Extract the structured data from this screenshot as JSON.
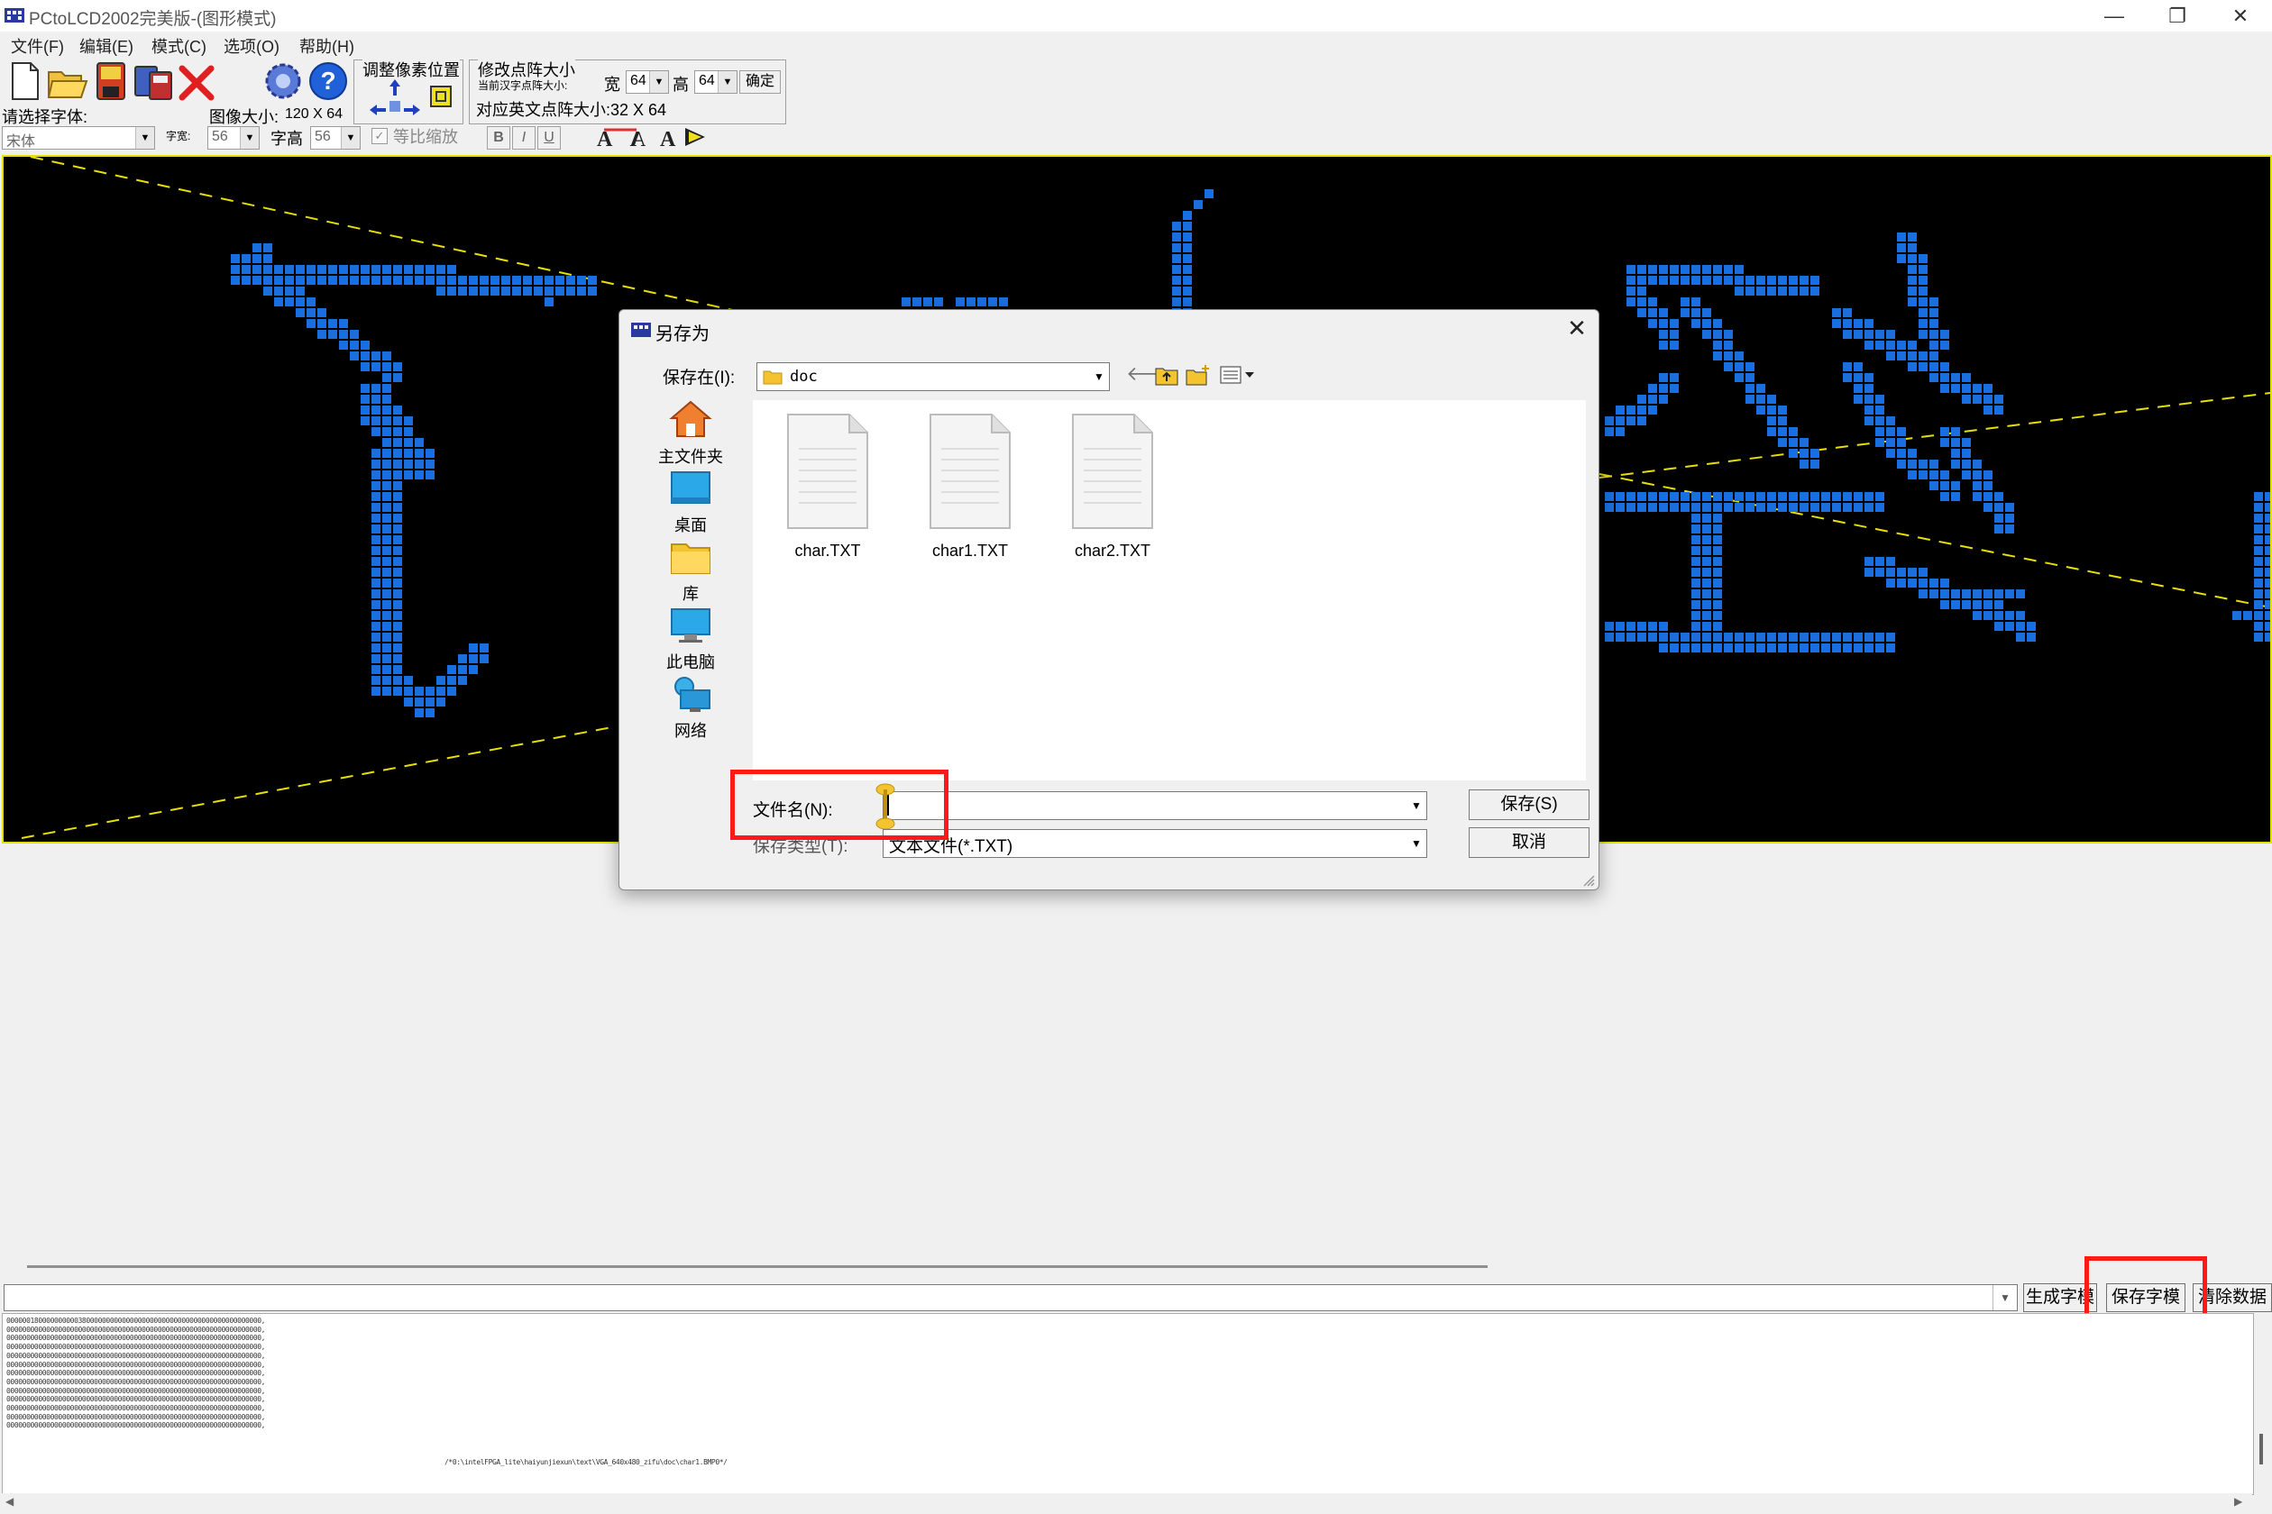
{
  "window": {
    "title": "PCtoLCD2002完美版-(图形模式)",
    "minimize": "—",
    "restore": "❐",
    "close": "✕"
  },
  "menu": [
    "文件(F)",
    "编辑(E)",
    "模式(C)",
    "选项(O)",
    "帮助(H)"
  ],
  "toolbar": {
    "pixel_position_label": "调整像素位置",
    "resize_label": "修改点阵大小",
    "resize_sub": "当前汉字点阵大小:",
    "width_label": "宽",
    "width_value": "64",
    "height_label": "高",
    "height_value": "64",
    "apply_label": "确定",
    "en_size_label": "对应英文点阵大小:32 X 64",
    "select_font_label": "请选择字体:",
    "font_value": "宋体",
    "image_size_label": "图像大小:",
    "image_size_value": "120 X 64",
    "char_width_label": "字宽:",
    "char_width_value": "56",
    "char_height_label": "字高",
    "char_height_value": "56",
    "proportional_label": "等比缩放",
    "bold": "B",
    "italic": "I",
    "underline": "U"
  },
  "bottom": {
    "generate_button": "生成字模",
    "save_button": "保存字模",
    "clear_button": "清除数据",
    "data_lines": [
      "0000001800000000003800000000000000000000000000000000000000000000,",
      "0000000000000000000000000000000000000000000000000000000000000000,",
      "0000000000000000000000000000000000000000000000000000000000000000,",
      "0000000000000000000000000000000000000000000000000000000000000000,",
      "0000000000000000000000000000000000000000000000000000000000000000,",
      "0000000000000000000000000000000000000000000000000000000000000000,",
      "0000000000000000000000000000000000000000000000000000000000000000,",
      "0000000000000000000000000000000000000000000000000000000000000000,",
      "0000000000000000000000000000000000000000000000000000000000000000,",
      "0000000000000000000000000000000000000000000000000000000000000000,",
      "0000000000000000000000000000000000000000000000000000000000000000,",
      "0000000000000000000000000000000000000000000000000000000000000000,",
      "0000000000000000000000000000000000000000000000000000000000000000,"
    ],
    "path_comment": "/*0:\\intelFPGA_lite\\haiyunjiexun\\text\\VGA_640x480_zifu\\doc\\char1.BMP0*/"
  },
  "dialog": {
    "title": "另存为",
    "save_in_label": "保存在(I):",
    "save_in_value": "doc",
    "places": [
      {
        "label": "主文件夹",
        "icon": "home-icon"
      },
      {
        "label": "桌面",
        "icon": "desktop-icon"
      },
      {
        "label": "库",
        "icon": "library-icon"
      },
      {
        "label": "此电脑",
        "icon": "computer-icon"
      },
      {
        "label": "网络",
        "icon": "network-icon"
      }
    ],
    "files": [
      "char.TXT",
      "char1.TXT",
      "char2.TXT"
    ],
    "filename_label": "文件名(N):",
    "filename_value": "",
    "filetype_label": "保存类型(T):",
    "filetype_value": "文本文件(*.TXT)",
    "save_button": "保存(S)",
    "cancel_button": "取消"
  },
  "colors": {
    "pixel": "#1a6fe0",
    "canvas": "#000000",
    "guide": "#e8e000",
    "highlight": "#ff1a1a"
  }
}
